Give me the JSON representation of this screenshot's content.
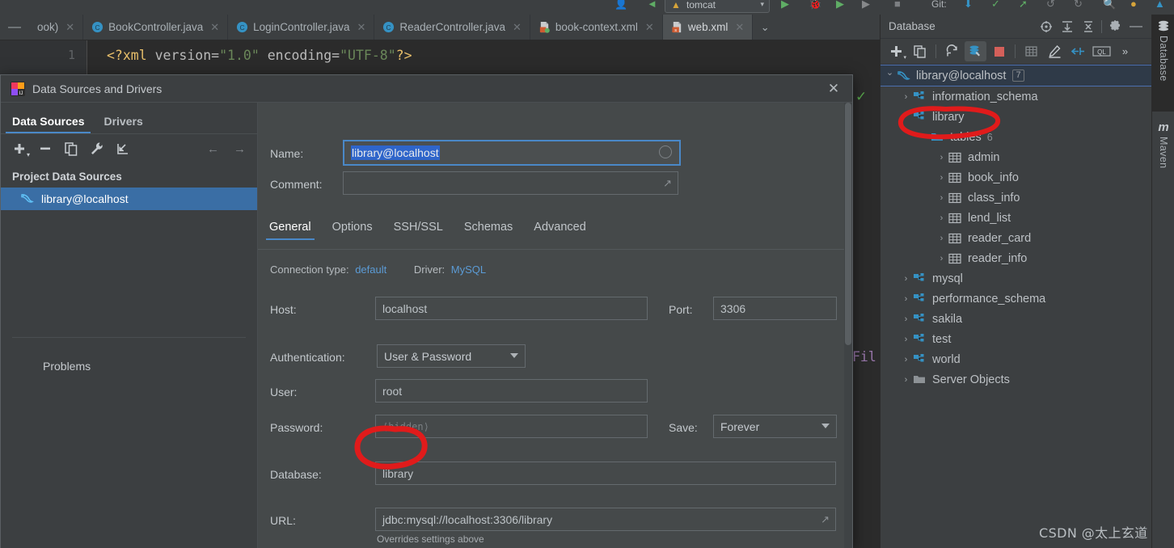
{
  "colors": {
    "accent_blue": "#4a88c7",
    "selection_blue": "#3a6ea5",
    "annotation_red": "#e01b1b",
    "panel_bg": "#3c3f41",
    "editor_bg": "#2b2b2b",
    "dialog_field_bg": "#45494a",
    "link_blue": "#5b9bd5",
    "table_icon_blue": "#3592c4"
  },
  "ide_toolbar": {
    "run_config": "tomcat",
    "icons": [
      "user-icon",
      "back-arrow-icon",
      "run-icon",
      "debug-icon",
      "run-coverage-icon",
      "profiler-icon",
      "stop-icon",
      "git-label",
      "update-project-icon",
      "commit-icon",
      "push-icon",
      "revert-icon",
      "history-icon",
      "search-icon",
      "warning-icon",
      "shield-icon"
    ],
    "git_label": "Git:"
  },
  "editor_tabs": {
    "minimize_label": "—",
    "chevron_label": "⌄",
    "items": [
      {
        "label": "ook)",
        "icon": "file-icon",
        "active": false,
        "partial": true
      },
      {
        "label": "BookController.java",
        "icon": "java-class-icon",
        "active": false
      },
      {
        "label": "LoginController.java",
        "icon": "java-class-icon",
        "active": false
      },
      {
        "label": "ReaderController.java",
        "icon": "java-class-icon",
        "active": false
      },
      {
        "label": "book-context.xml",
        "icon": "xml-file-icon",
        "active": false
      },
      {
        "label": "web.xml",
        "icon": "xml-web-icon",
        "active": true
      }
    ]
  },
  "editor": {
    "line_number": "1",
    "code": {
      "prefix": "<?xml ",
      "attr1": "version=",
      "val1": "\"1.0\"",
      "attr2": " encoding=",
      "val2": "\"UTF-8\"",
      "suffix": "?>"
    },
    "full_line": "<?xml version=\"1.0\" encoding=\"UTF-8\"?>",
    "inspection_status": "✓",
    "obscured_text": "Fil"
  },
  "database_panel": {
    "title": "Database",
    "header_icons": [
      "locate-icon",
      "expand-all-icon",
      "collapse-all-icon",
      "settings-gear-icon",
      "hide-icon"
    ],
    "toolbar_icons": [
      "add-icon",
      "duplicate-icon",
      "refresh-icon",
      "data-source-properties-icon",
      "stop-icon",
      "table-icon",
      "modify-icon",
      "jump-to-icon",
      "query-console-icon",
      "more-icon"
    ],
    "more_label": "»",
    "query_console_label": "QL",
    "tree": [
      {
        "label": "library@localhost",
        "icon": "mysql-dolphin-icon",
        "indent": 0,
        "arrow": "open",
        "badge": "7",
        "selected": true
      },
      {
        "label": "information_schema",
        "icon": "schema-icon",
        "indent": 1,
        "arrow": "closed"
      },
      {
        "label": "library",
        "icon": "schema-icon",
        "indent": 1,
        "arrow": "open",
        "annotated": true
      },
      {
        "label": "tables",
        "icon": "folder-icon",
        "indent": 2,
        "arrow": "open",
        "count": "6"
      },
      {
        "label": "admin",
        "icon": "table-icon",
        "indent": 3,
        "arrow": "closed"
      },
      {
        "label": "book_info",
        "icon": "table-icon",
        "indent": 3,
        "arrow": "closed"
      },
      {
        "label": "class_info",
        "icon": "table-icon",
        "indent": 3,
        "arrow": "closed"
      },
      {
        "label": "lend_list",
        "icon": "table-icon",
        "indent": 3,
        "arrow": "closed"
      },
      {
        "label": "reader_card",
        "icon": "table-icon",
        "indent": 3,
        "arrow": "closed"
      },
      {
        "label": "reader_info",
        "icon": "table-icon",
        "indent": 3,
        "arrow": "closed"
      },
      {
        "label": "mysql",
        "icon": "schema-icon",
        "indent": 1,
        "arrow": "closed"
      },
      {
        "label": "performance_schema",
        "icon": "schema-icon",
        "indent": 1,
        "arrow": "closed"
      },
      {
        "label": "sakila",
        "icon": "schema-icon",
        "indent": 1,
        "arrow": "closed"
      },
      {
        "label": "test",
        "icon": "schema-icon",
        "indent": 1,
        "arrow": "closed"
      },
      {
        "label": "world",
        "icon": "schema-icon",
        "indent": 1,
        "arrow": "closed"
      },
      {
        "label": "Server Objects",
        "icon": "folder-icon",
        "indent": 1,
        "arrow": "closed"
      }
    ]
  },
  "right_stripe": {
    "buttons": [
      {
        "label": "Database",
        "icon": "database-icon",
        "active": true
      },
      {
        "label": "Maven",
        "icon": "maven-icon",
        "active": false
      }
    ]
  },
  "dialog": {
    "title": "Data Sources and Drivers",
    "icon": "intellij-idea-icon",
    "close_label": "✕",
    "left": {
      "tabs": [
        {
          "label": "Data Sources",
          "active": true
        },
        {
          "label": "Drivers",
          "active": false
        }
      ],
      "toolbar_icons": [
        "add-icon",
        "remove-icon",
        "duplicate-icon",
        "wrench-icon",
        "import-icon",
        "back-arrow-icon",
        "forward-arrow-icon"
      ],
      "group_title": "Project Data Sources",
      "data_sources": [
        {
          "label": "library@localhost",
          "icon": "mysql-dolphin-icon",
          "selected": true
        }
      ],
      "problems_label": "Problems"
    },
    "form": {
      "name_label": "Name:",
      "name_value": "library@localhost",
      "comment_label": "Comment:",
      "comment_value": "",
      "tabs": [
        {
          "label": "General",
          "active": true
        },
        {
          "label": "Options",
          "active": false
        },
        {
          "label": "SSH/SSL",
          "active": false
        },
        {
          "label": "Schemas",
          "active": false
        },
        {
          "label": "Advanced",
          "active": false
        }
      ],
      "connection_type_label": "Connection type:",
      "connection_type_value": "default",
      "driver_label": "Driver:",
      "driver_value": "MySQL",
      "host_label": "Host:",
      "host_value": "localhost",
      "port_label": "Port:",
      "port_value": "3306",
      "auth_label": "Authentication:",
      "auth_value": "User & Password",
      "user_label": "User:",
      "user_value": "root",
      "password_label": "Password:",
      "password_placeholder": "⟨hidden⟩",
      "save_label": "Save:",
      "save_value": "Forever",
      "database_label": "Database:",
      "database_value": "library",
      "url_label": "URL:",
      "url_value": "jdbc:mysql://localhost:3306/library",
      "url_hint": "Overrides settings above"
    }
  },
  "watermark": "CSDN @太上玄道"
}
